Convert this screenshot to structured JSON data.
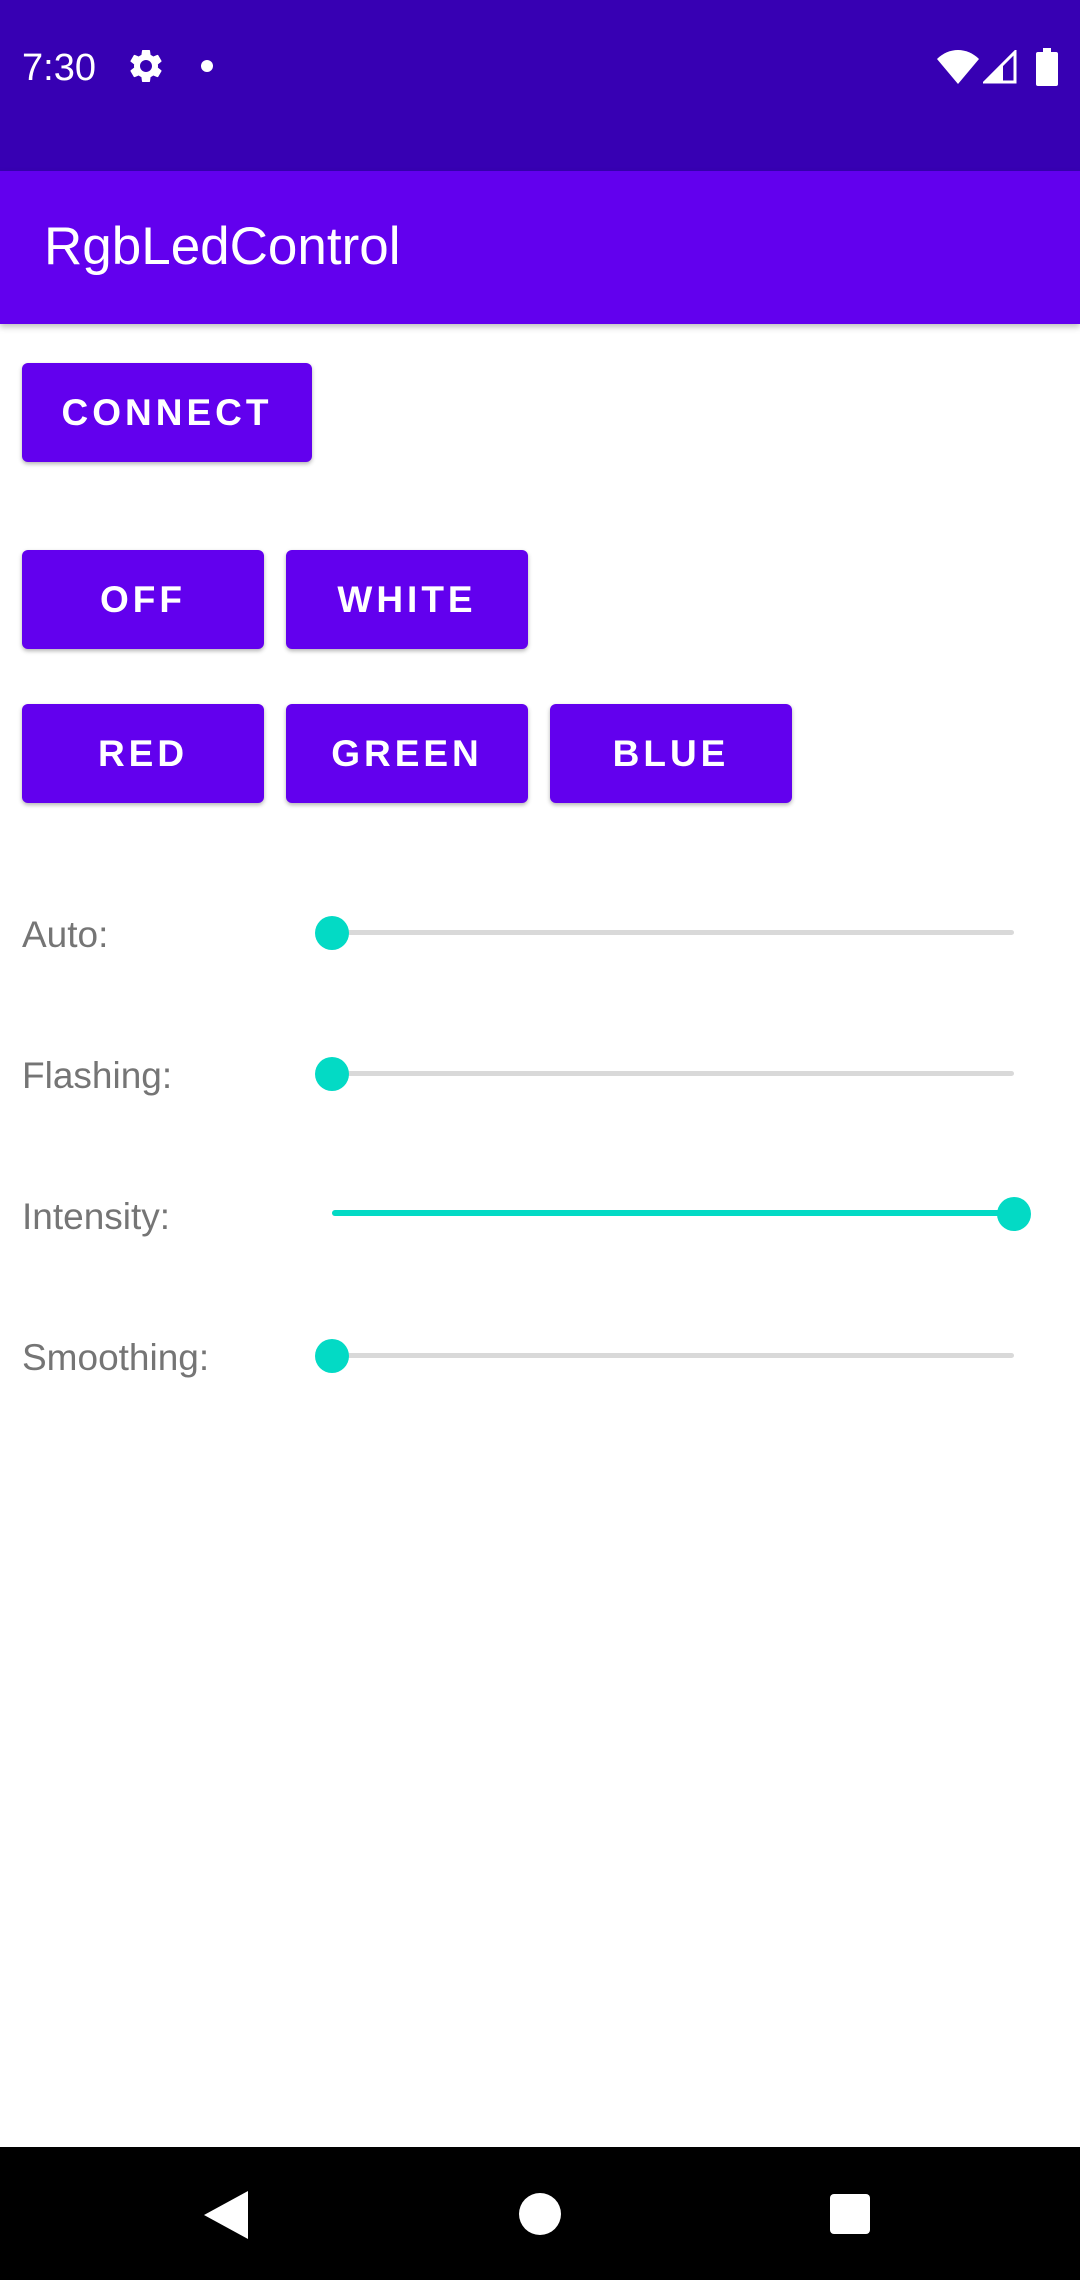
{
  "status_bar": {
    "time": "7:30",
    "icons": [
      "gear-icon",
      "notification-dot-icon",
      "wifi-icon",
      "signal-icon",
      "battery-icon"
    ]
  },
  "app_bar": {
    "title": "RgbLedControl"
  },
  "buttons": {
    "connect": "CONNECT",
    "off": "OFF",
    "white": "WHITE",
    "red": "RED",
    "green": "GREEN",
    "blue": "BLUE"
  },
  "sliders": [
    {
      "label": "Auto:",
      "value": 0
    },
    {
      "label": "Flashing:",
      "value": 0
    },
    {
      "label": "Intensity:",
      "value": 1
    },
    {
      "label": "Smoothing:",
      "value": 0
    }
  ],
  "nav_bar": {
    "icons": [
      "back-icon",
      "home-icon",
      "recents-icon"
    ]
  },
  "colors": {
    "status_bar": "#3700b3",
    "primary": "#6200ee",
    "accent": "#03dac5",
    "track": "#d9d9d9",
    "label": "#757575"
  }
}
